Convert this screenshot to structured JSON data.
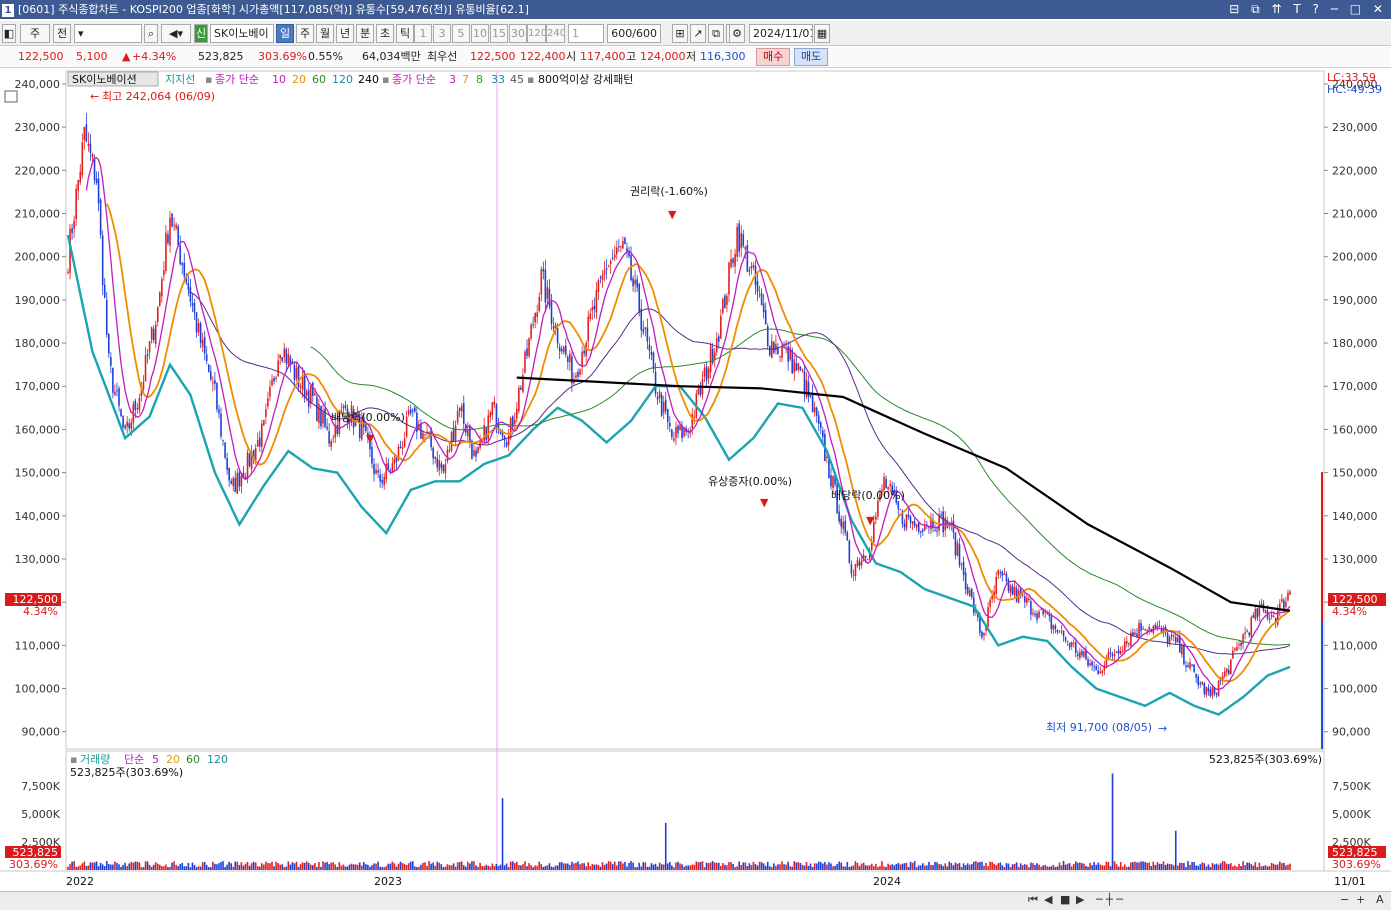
{
  "window": {
    "number": "1",
    "title": "[0601] 주식종합차트 - KOSPI200 업종[화학] 시가총액[117,085(억)] 유통수[59,476(천)] 유통비율[62.1]",
    "controls": [
      "⊟",
      "⧉",
      "⇈",
      "T",
      "?",
      "─",
      "□",
      "✕"
    ]
  },
  "toolbar": {
    "code": "주",
    "prev": "전",
    "stock_name": "SK이노베이",
    "sin": "신",
    "periods": [
      "일",
      "주",
      "월",
      "년",
      "분",
      "초",
      "틱"
    ],
    "active_period": "일",
    "intervals": [
      "1",
      "3",
      "5",
      "10",
      "15",
      "30",
      "120",
      "240"
    ],
    "count": "1",
    "range": "600/600",
    "date": "2024/11/01"
  },
  "quote": {
    "price": "122,500",
    "change": "5,100",
    "change_pct": "+4.34%",
    "volume": "523,825",
    "volume_pct": "303.69%",
    "turnover_pct": "0.55%",
    "amount": "64,034백만",
    "best_bid_label": "최우선",
    "ask": "122,500",
    "bid": "122,400",
    "open_label": "시",
    "open": "117,400",
    "high_label": "고",
    "high": "124,000",
    "low_label": "저",
    "low": "116,300",
    "buy": "매수",
    "sell": "매도"
  },
  "legend": {
    "name": "SK이노베이션",
    "support": "지지선",
    "ma_label": "종가 단순",
    "ma_periods": [
      "10",
      "20",
      "60",
      "120",
      "240"
    ],
    "ma_colors": [
      "#c01cc0",
      "#f08c00",
      "#2a8a2a",
      "#1a8aa0",
      "#000000"
    ],
    "ma2_label": "종가 단순",
    "ma2_periods": [
      "3",
      "7",
      "8",
      "33",
      "45"
    ],
    "ma2_colors": [
      "#c01cc0",
      "#f08c00",
      "#2aaa2a",
      "#1a8aa0",
      "#555555"
    ],
    "pattern": "800억이상 강세패턴"
  },
  "corner": {
    "lc": "LC:33.59",
    "hc": "HC:-49.39"
  },
  "annotations": {
    "high": "최고 242,064 (06/09)",
    "low": "최저 91,700 (08/05)",
    "rights": "권리락(-1.60%)",
    "dividend1": "배당락(0.00%)",
    "increase": "유상증자(0.00%)",
    "dividend2": "배당락(0.00%)"
  },
  "price_tag": {
    "price": "122,500",
    "pct": "4.34%"
  },
  "volume_panel": {
    "label": "거래량",
    "ma_label": "단순",
    "ma_periods": [
      "5",
      "20",
      "60",
      "120"
    ],
    "ma_colors": [
      "#c01cc0",
      "#e0a000",
      "#2a8a2a",
      "#1a8aa0"
    ],
    "current": "523,825주(303.69%)",
    "tag_value": "523,825",
    "tag_pct": "303.69%"
  },
  "x_labels": [
    "2022",
    "2023",
    "2024"
  ],
  "x_end_label": "11/01",
  "chart_data": {
    "type": "candlestick",
    "title": "SK이노베이션",
    "y_ticks": [
      240000,
      230000,
      220000,
      210000,
      200000,
      190000,
      180000,
      170000,
      160000,
      150000,
      140000,
      130000,
      120000,
      110000,
      100000,
      90000
    ],
    "ylim": [
      86000,
      243000
    ],
    "volume_ticks": [
      "7,500K",
      "5,000K",
      "2,500K"
    ],
    "volume_ylim": [
      0,
      9000000
    ],
    "last_close": 122500,
    "high": {
      "value": 242064,
      "date": "06/09"
    },
    "low": {
      "value": 91700,
      "date": "08/05"
    },
    "price_path": [
      [
        0,
        200000
      ],
      [
        8,
        228000
      ],
      [
        14,
        218000
      ],
      [
        20,
        175000
      ],
      [
        28,
        158000
      ],
      [
        36,
        170000
      ],
      [
        44,
        188000
      ],
      [
        50,
        210000
      ],
      [
        58,
        195000
      ],
      [
        64,
        182000
      ],
      [
        72,
        168000
      ],
      [
        80,
        146000
      ],
      [
        88,
        152000
      ],
      [
        96,
        160000
      ],
      [
        104,
        180000
      ],
      [
        112,
        172000
      ],
      [
        120,
        167000
      ],
      [
        128,
        158000
      ],
      [
        136,
        165000
      ],
      [
        144,
        160000
      ],
      [
        152,
        148000
      ],
      [
        160,
        152000
      ],
      [
        168,
        163000
      ],
      [
        176,
        158000
      ],
      [
        184,
        150000
      ],
      [
        192,
        166000
      ],
      [
        200,
        152000
      ],
      [
        208,
        165000
      ],
      [
        216,
        158000
      ],
      [
        224,
        175000
      ],
      [
        232,
        195000
      ],
      [
        240,
        182000
      ],
      [
        248,
        172000
      ],
      [
        256,
        185000
      ],
      [
        264,
        198000
      ],
      [
        272,
        202000
      ],
      [
        280,
        188000
      ],
      [
        288,
        170000
      ],
      [
        296,
        158000
      ],
      [
        304,
        160000
      ],
      [
        312,
        172000
      ],
      [
        320,
        185000
      ],
      [
        328,
        206000
      ],
      [
        336,
        195000
      ],
      [
        344,
        180000
      ],
      [
        352,
        178000
      ],
      [
        360,
        172000
      ],
      [
        368,
        160000
      ],
      [
        376,
        145000
      ],
      [
        384,
        128000
      ],
      [
        392,
        132000
      ],
      [
        400,
        148000
      ],
      [
        408,
        140000
      ],
      [
        416,
        138000
      ],
      [
        424,
        139000
      ],
      [
        432,
        138000
      ],
      [
        440,
        125000
      ],
      [
        448,
        112000
      ],
      [
        456,
        126000
      ],
      [
        464,
        122000
      ],
      [
        472,
        119000
      ],
      [
        480,
        116000
      ],
      [
        488,
        112000
      ],
      [
        496,
        108000
      ],
      [
        504,
        104000
      ],
      [
        512,
        108000
      ],
      [
        520,
        112000
      ],
      [
        528,
        115000
      ],
      [
        536,
        113000
      ],
      [
        544,
        110000
      ],
      [
        552,
        103000
      ],
      [
        560,
        98000
      ],
      [
        568,
        104000
      ],
      [
        576,
        112000
      ],
      [
        584,
        118000
      ],
      [
        592,
        117000
      ],
      [
        599,
        122500
      ]
    ],
    "ma240_path": [
      [
        220,
        172000
      ],
      [
        260,
        171000
      ],
      [
        300,
        170000
      ],
      [
        340,
        169500
      ],
      [
        380,
        167500
      ],
      [
        420,
        159000
      ],
      [
        460,
        151000
      ],
      [
        500,
        138000
      ],
      [
        540,
        128000
      ],
      [
        570,
        120000
      ],
      [
        599,
        118000
      ]
    ],
    "support_path": [
      [
        0,
        205000
      ],
      [
        12,
        178000
      ],
      [
        20,
        168000
      ],
      [
        28,
        158000
      ],
      [
        40,
        163000
      ],
      [
        50,
        175000
      ],
      [
        60,
        168000
      ],
      [
        72,
        150000
      ],
      [
        84,
        138000
      ],
      [
        96,
        147000
      ],
      [
        108,
        155000
      ],
      [
        120,
        151000
      ],
      [
        132,
        150000
      ],
      [
        144,
        142000
      ],
      [
        156,
        136000
      ],
      [
        168,
        146000
      ],
      [
        180,
        148000
      ],
      [
        192,
        148000
      ],
      [
        204,
        152000
      ],
      [
        216,
        154000
      ],
      [
        228,
        160000
      ],
      [
        240,
        165000
      ],
      [
        252,
        162000
      ],
      [
        264,
        157000
      ],
      [
        276,
        162000
      ],
      [
        288,
        170000
      ],
      [
        300,
        170000
      ],
      [
        312,
        163000
      ],
      [
        324,
        153000
      ],
      [
        336,
        158000
      ],
      [
        348,
        166000
      ],
      [
        360,
        165000
      ],
      [
        372,
        155000
      ],
      [
        384,
        139000
      ],
      [
        396,
        129000
      ],
      [
        408,
        127000
      ],
      [
        420,
        123000
      ],
      [
        432,
        121000
      ],
      [
        444,
        119000
      ],
      [
        456,
        110000
      ],
      [
        468,
        112000
      ],
      [
        480,
        111000
      ],
      [
        492,
        105000
      ],
      [
        504,
        100000
      ],
      [
        516,
        98000
      ],
      [
        528,
        96000
      ],
      [
        540,
        99000
      ],
      [
        552,
        96000
      ],
      [
        564,
        94000
      ],
      [
        576,
        98000
      ],
      [
        588,
        103000
      ],
      [
        599,
        105000
      ]
    ],
    "volume_spikes": [
      [
        213,
        6400000
      ],
      [
        293,
        4200000
      ],
      [
        512,
        8600000
      ],
      [
        543,
        3500000
      ]
    ]
  }
}
